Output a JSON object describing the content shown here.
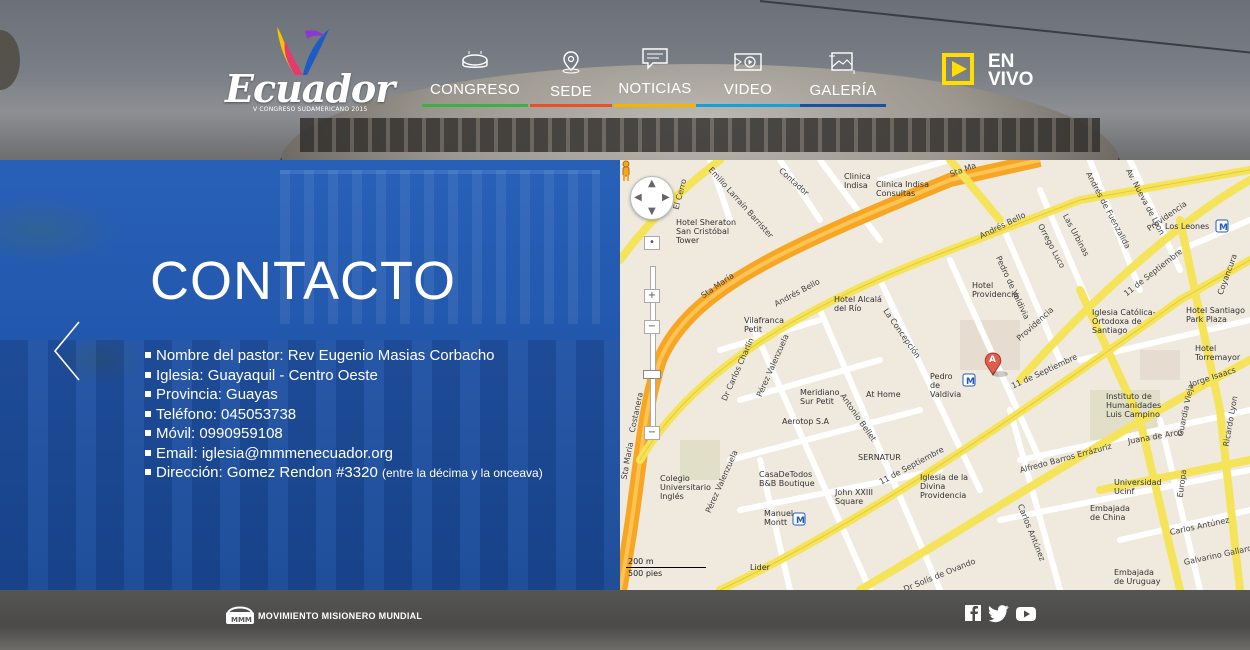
{
  "header": {
    "logo": {
      "wordmark": "Ecuador",
      "subtitle": "V CONGRESO SUDAMERICANO 2015"
    },
    "nav": [
      {
        "label": "CONGRESO",
        "icon": "stadium-icon",
        "accent": "#3fae49"
      },
      {
        "label": "SEDE",
        "icon": "location-pin-icon",
        "accent": "#e2522b"
      },
      {
        "label": "NOTICIAS",
        "icon": "speech-bubble-icon",
        "accent": "#f2b600"
      },
      {
        "label": "VIDEO",
        "icon": "video-play-icon",
        "accent": "#1f9bd8"
      },
      {
        "label": "GALERÍA",
        "icon": "image-icon",
        "accent": "#1b4fa5"
      }
    ],
    "live": {
      "line1": "EN",
      "line2": "VIVO",
      "color": "#ffde00"
    }
  },
  "contact": {
    "title": "CONTACTO",
    "items": [
      {
        "label": "Nombre del pastor: ",
        "value": "Rev Eugenio Masias Corbacho",
        "note": ""
      },
      {
        "label": "Iglesia: ",
        "value": "Guayaquil - Centro Oeste",
        "note": ""
      },
      {
        "label": "Provincia: ",
        "value": "Guayas",
        "note": ""
      },
      {
        "label": "Teléfono: ",
        "value": "045053738",
        "note": ""
      },
      {
        "label": "Móvil: ",
        "value": "0990959108",
        "note": ""
      },
      {
        "label": "Email: ",
        "value": "iglesia@mmmenecuador.org",
        "note": ""
      },
      {
        "label": "Dirección: ",
        "value": "Gomez Rendon #3320 ",
        "note": "(entre la décima y la onceava)"
      }
    ],
    "panel_color": "#1d58b5"
  },
  "map": {
    "marker_label": "A",
    "scale_metric": "200 m",
    "scale_imperial": "500 pies",
    "places": [
      "Clinica Indisa",
      "Clinica Indisa Consultas",
      "Hotel Sheraton San Cristóbal Tower",
      "Hotel Alcalá del Río",
      "Hotel Providencia",
      "Iglesia Católica-Ortodoxa de Santiago",
      "Hotel Santiago Park Plaza",
      "Hotel Torremayor",
      "Instituto de Humanidades Luis Campino",
      "Vilafranca Petit",
      "Meridiano Sur Petit",
      "At Home",
      "Aerotop S.A",
      "SERNATUR",
      "Pedro de Valdivia",
      "Los Leones",
      "Colegio Universitario Inglés",
      "CasaDeTodos B&B Boutique",
      "John XXIII Square",
      "Iglesia de la Divina Providencia",
      "Manuel Montt",
      "Universidad Ucinf",
      "Embajada de China",
      "Embajada de Uruguay",
      "Lider"
    ],
    "streets": [
      "Andrés Bello",
      "Sta María",
      "Costanera",
      "Providencia",
      "11 de Septiembre",
      "Pedro de Valdivia",
      "La Concepción",
      "Antonio Bellet",
      "Dr Carlos Charlín",
      "Pérez Valenzuela",
      "Alfredo Barros Errázuriz",
      "Juana de Arco",
      "Jorge Isaacs",
      "Guardia Vieja",
      "Ricardo Lyon",
      "Carlos Antúnez",
      "Galvarino Gallardo",
      "Dr Solís de Ovando",
      "El Cerro",
      "Emilio Larraín Barrister",
      "Contador",
      "Orrego Luco",
      "Las Urbinas",
      "Andrés de Fuenzalida",
      "Av. Nueva de Lyon",
      "Coyancura",
      "Europa",
      "Sta Maria",
      "Sta Ma"
    ]
  },
  "footer": {
    "org_name": "MOVIMIENTO MISIONERO MUNDIAL",
    "social": [
      {
        "name": "facebook-icon"
      },
      {
        "name": "twitter-icon"
      },
      {
        "name": "youtube-icon"
      }
    ]
  }
}
